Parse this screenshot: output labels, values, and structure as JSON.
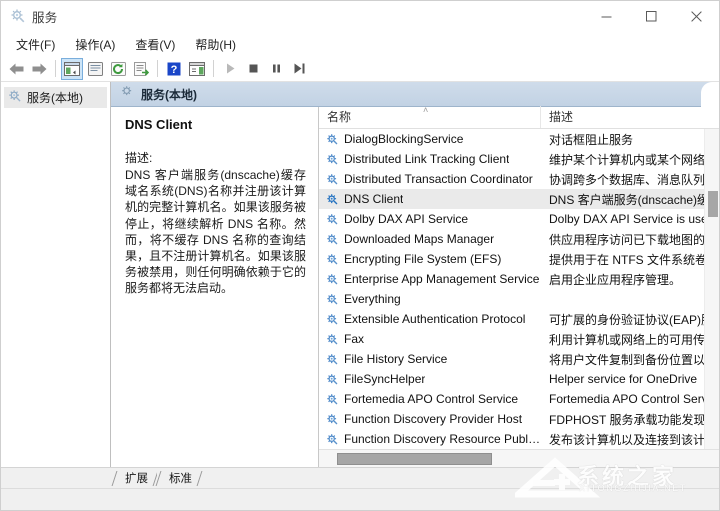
{
  "window": {
    "title": "服务",
    "title_icon": "services-gear-icon",
    "caption_buttons": [
      {
        "name": "minimize-button",
        "glyph": "minimize-icon"
      },
      {
        "name": "maximize-button",
        "glyph": "maximize-icon"
      },
      {
        "name": "close-button",
        "glyph": "close-icon"
      }
    ]
  },
  "menubar": {
    "items": [
      {
        "label": "文件(F)",
        "name": "menu-file"
      },
      {
        "label": "操作(A)",
        "name": "menu-action"
      },
      {
        "label": "查看(V)",
        "name": "menu-view"
      },
      {
        "label": "帮助(H)",
        "name": "menu-help"
      }
    ]
  },
  "toolbar": {
    "buttons": [
      {
        "name": "back-button",
        "icon": "arrow-left-icon"
      },
      {
        "name": "forward-button",
        "icon": "arrow-right-icon"
      },
      {
        "name": "show-hide-tree-button",
        "icon": "console-tree-icon",
        "active": true
      },
      {
        "name": "properties-button",
        "icon": "properties-icon"
      },
      {
        "name": "refresh-button",
        "icon": "refresh-icon"
      },
      {
        "name": "export-list-button",
        "icon": "export-list-icon"
      },
      {
        "name": "help-button",
        "icon": "help-question-icon"
      },
      {
        "name": "show-action-pane-button",
        "icon": "action-pane-icon"
      },
      {
        "name": "start-service-button",
        "icon": "play-icon"
      },
      {
        "name": "stop-service-button",
        "icon": "stop-icon"
      },
      {
        "name": "pause-service-button",
        "icon": "pause-icon"
      },
      {
        "name": "restart-service-button",
        "icon": "restart-icon"
      }
    ]
  },
  "tree": {
    "node_label": "服务(本地)",
    "node_icon": "services-gear-icon"
  },
  "pane_header": {
    "title": "服务(本地)",
    "icon": "services-gear-icon"
  },
  "detail": {
    "service_name": "DNS Client",
    "description_label": "描述:",
    "description_text": "DNS 客户端服务(dnscache)缓存域名系统(DNS)名称并注册该计算机的完整计算机名。如果该服务被停止，将继续解析 DNS 名称。然而，将不缓存 DNS 名称的查询结果，且不注册计算机名。如果该服务被禁用，则任何明确依赖于它的服务都将无法启动。"
  },
  "list": {
    "columns": [
      {
        "label": "名称",
        "name": "column-header-name",
        "sorted": "ascending"
      },
      {
        "label": "描述",
        "name": "column-header-description"
      }
    ],
    "sort_arrow_glyph": "˄",
    "rows": [
      {
        "name": "DialogBlockingService",
        "description": "对话框阻止服务",
        "selected": false
      },
      {
        "name": "Distributed Link Tracking Client",
        "description": "维护某个计算机内或某个网络中",
        "selected": false
      },
      {
        "name": "Distributed Transaction Coordinator",
        "description": "协调跨多个数据库、消息队列、",
        "selected": false
      },
      {
        "name": "DNS Client",
        "description": "DNS 客户端服务(dnscache)缓存",
        "selected": true
      },
      {
        "name": "Dolby DAX API Service",
        "description": "Dolby DAX API Service is used",
        "selected": false
      },
      {
        "name": "Downloaded Maps Manager",
        "description": "供应用程序访问已下载地图的 W",
        "selected": false
      },
      {
        "name": "Encrypting File System (EFS)",
        "description": "提供用于在 NTFS 文件系统卷上",
        "selected": false
      },
      {
        "name": "Enterprise App Management Service",
        "description": "启用企业应用程序管理。",
        "selected": false
      },
      {
        "name": "Everything",
        "description": "",
        "selected": false
      },
      {
        "name": "Extensible Authentication Protocol",
        "description": "可扩展的身份验证协议(EAP)服务",
        "selected": false
      },
      {
        "name": "Fax",
        "description": "利用计算机或网络上的可用传真",
        "selected": false
      },
      {
        "name": "File History Service",
        "description": "将用户文件复制到备份位置以防",
        "selected": false
      },
      {
        "name": "FileSyncHelper",
        "description": "Helper service for OneDrive",
        "selected": false
      },
      {
        "name": "Fortemedia APO Control Service",
        "description": "Fortemedia APO Control Servic",
        "selected": false
      },
      {
        "name": "Function Discovery Provider Host",
        "description": "FDPHOST 服务承载功能发现(F",
        "selected": false
      },
      {
        "name": "Function Discovery Resource Public...",
        "description": "发布该计算机以及连接到该计算",
        "selected": false
      }
    ]
  },
  "tabs": [
    {
      "label": "扩展",
      "name": "tab-extended"
    },
    {
      "label": "标准",
      "name": "tab-standard"
    }
  ],
  "watermark": {
    "text": "系统之家",
    "subtext": "XITONGZHIJIA.NET"
  }
}
